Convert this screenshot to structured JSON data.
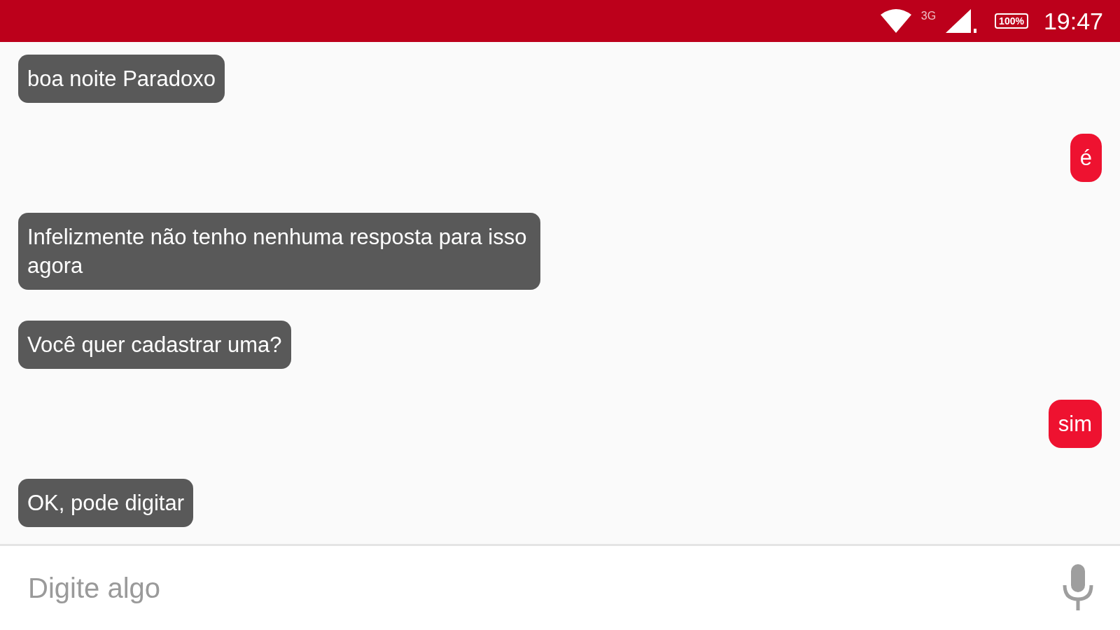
{
  "status_bar": {
    "network": "3G",
    "battery": "100%",
    "time": "19:47"
  },
  "messages": [
    {
      "kind": "bot",
      "text": "boa noite Paradoxo"
    },
    {
      "kind": "user",
      "text": "é"
    },
    {
      "kind": "bot",
      "text": "Infelizmente não tenho nenhuma resposta para isso agora"
    },
    {
      "kind": "bot",
      "text": "Você quer cadastrar uma?"
    },
    {
      "kind": "user",
      "text": "sim"
    },
    {
      "kind": "bot",
      "text": "OK, pode digitar"
    }
  ],
  "composer": {
    "placeholder": "Digite algo"
  }
}
